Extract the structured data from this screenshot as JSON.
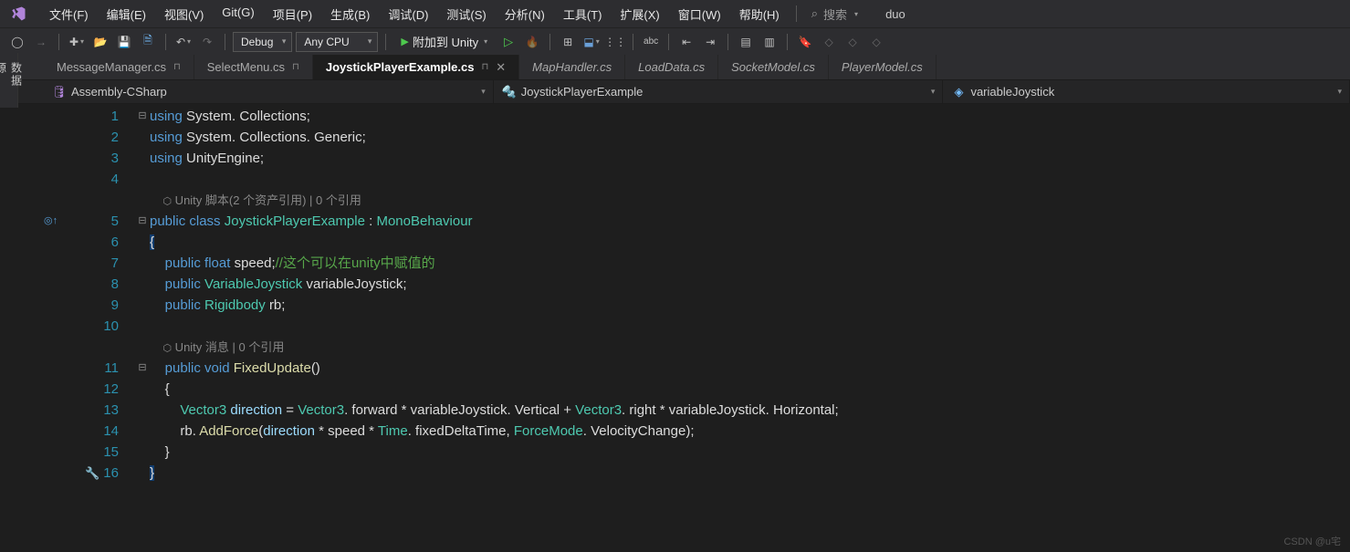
{
  "menu": {
    "items": [
      "文件(F)",
      "编辑(E)",
      "视图(V)",
      "Git(G)",
      "项目(P)",
      "生成(B)",
      "调试(D)",
      "测试(S)",
      "分析(N)",
      "工具(T)",
      "扩展(X)",
      "窗口(W)",
      "帮助(H)"
    ],
    "search_placeholder": "搜索",
    "user": "duo"
  },
  "toolbar": {
    "config": "Debug",
    "platform": "Any CPU",
    "run_label": "附加到 Unity"
  },
  "tabs": [
    {
      "name": "MessageManager.cs",
      "pinned": true,
      "active": false
    },
    {
      "name": "SelectMenu.cs",
      "pinned": true,
      "active": false
    },
    {
      "name": "JoystickPlayerExample.cs",
      "pinned": true,
      "active": true
    },
    {
      "name": "MapHandler.cs",
      "pinned": false,
      "active": false,
      "preview": true
    },
    {
      "name": "LoadData.cs",
      "pinned": false,
      "active": false,
      "preview": true
    },
    {
      "name": "SocketModel.cs",
      "pinned": false,
      "active": false,
      "preview": true
    },
    {
      "name": "PlayerModel.cs",
      "pinned": false,
      "active": false,
      "preview": true
    }
  ],
  "nav": {
    "project": "Assembly-CSharp",
    "class": "JoystickPlayerExample",
    "member": "variableJoystick"
  },
  "sidebar_label": "数据源",
  "code": {
    "hints": {
      "class": "Unity 脚本(2 个资产引用) | 0 个引用",
      "method": "Unity 消息 | 0 个引用"
    },
    "lines": [
      {
        "n": 1,
        "fold": "⊟",
        "seg": [
          [
            "kw",
            "using"
          ],
          [
            "punc",
            " "
          ],
          [
            "ident",
            "System"
          ],
          [
            "punc",
            ". "
          ],
          [
            "ident",
            "Collections"
          ],
          [
            "punc",
            ";"
          ]
        ]
      },
      {
        "n": 2,
        "seg": [
          [
            "kw",
            "using"
          ],
          [
            "punc",
            " "
          ],
          [
            "ident",
            "System"
          ],
          [
            "punc",
            ". "
          ],
          [
            "ident",
            "Collections"
          ],
          [
            "punc",
            ". "
          ],
          [
            "ident",
            "Generic"
          ],
          [
            "punc",
            ";"
          ]
        ]
      },
      {
        "n": 3,
        "seg": [
          [
            "kw",
            "using"
          ],
          [
            "punc",
            " "
          ],
          [
            "ident",
            "UnityEngine"
          ],
          [
            "punc",
            ";"
          ]
        ]
      },
      {
        "n": 4,
        "seg": []
      },
      {
        "hint": "class"
      },
      {
        "n": 5,
        "fold": "⊟",
        "margin": "◎↑",
        "seg": [
          [
            "kw",
            "public"
          ],
          [
            "punc",
            " "
          ],
          [
            "kw",
            "class"
          ],
          [
            "punc",
            " "
          ],
          [
            "type",
            "JoystickPlayerExample"
          ],
          [
            "punc",
            " : "
          ],
          [
            "type",
            "MonoBehaviour"
          ]
        ]
      },
      {
        "n": 6,
        "seg": [
          [
            "punc",
            "{"
          ]
        ],
        "hl": true
      },
      {
        "n": 7,
        "seg": [
          [
            "punc",
            "    "
          ],
          [
            "kw",
            "public"
          ],
          [
            "punc",
            " "
          ],
          [
            "kw",
            "float"
          ],
          [
            "punc",
            " "
          ],
          [
            "ident",
            "speed"
          ],
          [
            "punc",
            ";"
          ],
          [
            "comment",
            "//这个可以在unity中赋值的"
          ]
        ]
      },
      {
        "n": 8,
        "seg": [
          [
            "punc",
            "    "
          ],
          [
            "kw",
            "public"
          ],
          [
            "punc",
            " "
          ],
          [
            "type",
            "VariableJoystick"
          ],
          [
            "punc",
            " "
          ],
          [
            "ident",
            "variableJoystick"
          ],
          [
            "punc",
            ";"
          ]
        ]
      },
      {
        "n": 9,
        "seg": [
          [
            "punc",
            "    "
          ],
          [
            "kw",
            "public"
          ],
          [
            "punc",
            " "
          ],
          [
            "type",
            "Rigidbody"
          ],
          [
            "punc",
            " "
          ],
          [
            "ident",
            "rb"
          ],
          [
            "punc",
            ";"
          ]
        ]
      },
      {
        "n": 10,
        "seg": []
      },
      {
        "hint": "method"
      },
      {
        "n": 11,
        "fold": "⊟",
        "seg": [
          [
            "punc",
            "    "
          ],
          [
            "kw",
            "public"
          ],
          [
            "punc",
            " "
          ],
          [
            "kw",
            "void"
          ],
          [
            "punc",
            " "
          ],
          [
            "method",
            "FixedUpdate"
          ],
          [
            "punc",
            "()"
          ]
        ]
      },
      {
        "n": 12,
        "seg": [
          [
            "punc",
            "    {"
          ]
        ]
      },
      {
        "n": 13,
        "seg": [
          [
            "punc",
            "        "
          ],
          [
            "type",
            "Vector3"
          ],
          [
            "punc",
            " "
          ],
          [
            "field",
            "direction"
          ],
          [
            "punc",
            " = "
          ],
          [
            "type",
            "Vector3"
          ],
          [
            "punc",
            ". "
          ],
          [
            "ident",
            "forward"
          ],
          [
            "punc",
            " * "
          ],
          [
            "ident",
            "variableJoystick"
          ],
          [
            "punc",
            ". "
          ],
          [
            "ident",
            "Vertical"
          ],
          [
            "punc",
            " + "
          ],
          [
            "type",
            "Vector3"
          ],
          [
            "punc",
            ". "
          ],
          [
            "ident",
            "right"
          ],
          [
            "punc",
            " * "
          ],
          [
            "ident",
            "variableJoystick"
          ],
          [
            "punc",
            ". "
          ],
          [
            "ident",
            "Horizontal"
          ],
          [
            "punc",
            ";"
          ]
        ]
      },
      {
        "n": 14,
        "seg": [
          [
            "punc",
            "        "
          ],
          [
            "ident",
            "rb"
          ],
          [
            "punc",
            ". "
          ],
          [
            "method",
            "AddForce"
          ],
          [
            "punc",
            "("
          ],
          [
            "field",
            "direction"
          ],
          [
            "punc",
            " * "
          ],
          [
            "ident",
            "speed"
          ],
          [
            "punc",
            " * "
          ],
          [
            "type",
            "Time"
          ],
          [
            "punc",
            ". "
          ],
          [
            "ident",
            "fixedDeltaTime"
          ],
          [
            "punc",
            ", "
          ],
          [
            "type",
            "ForceMode"
          ],
          [
            "punc",
            ". "
          ],
          [
            "ident",
            "VelocityChange"
          ],
          [
            "punc",
            ");"
          ]
        ]
      },
      {
        "n": 15,
        "seg": [
          [
            "punc",
            "    }"
          ]
        ]
      },
      {
        "n": 16,
        "wrench": true,
        "seg": [
          [
            "punc",
            "}"
          ]
        ],
        "hl": true
      }
    ]
  },
  "watermark": "CSDN @u宅"
}
